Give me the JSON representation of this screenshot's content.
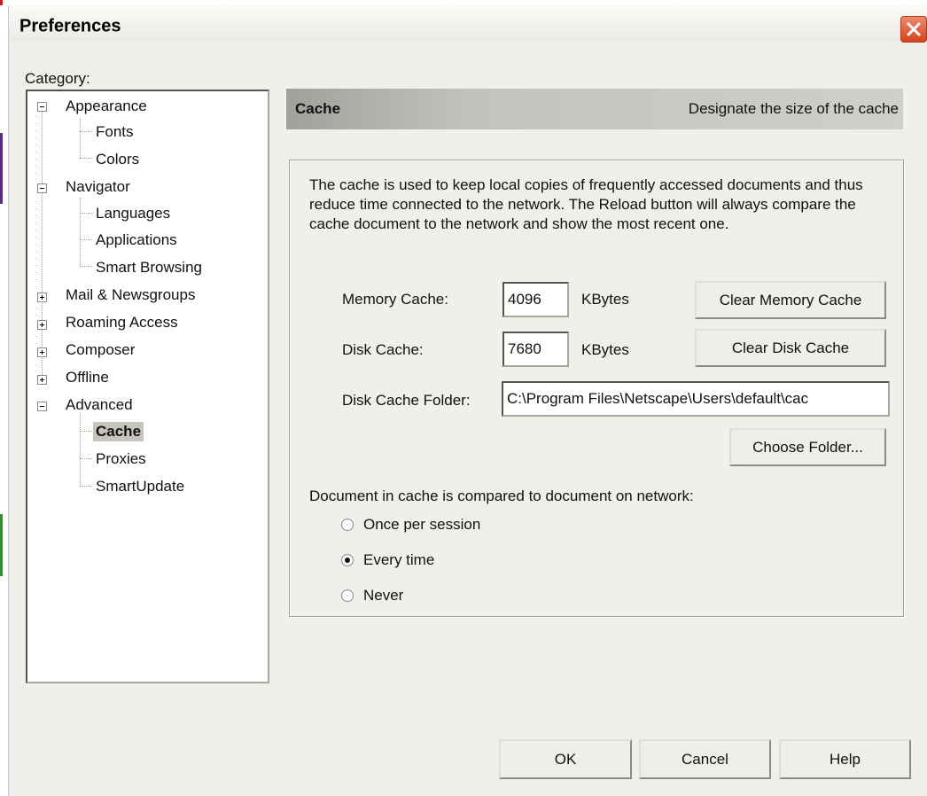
{
  "window": {
    "title": "Preferences"
  },
  "category": {
    "label": "Category:",
    "tree": [
      {
        "label": "Appearance",
        "expander": "minus"
      },
      {
        "label": "Fonts"
      },
      {
        "label": "Colors"
      },
      {
        "label": "Navigator",
        "expander": "minus"
      },
      {
        "label": "Languages"
      },
      {
        "label": "Applications"
      },
      {
        "label": "Smart Browsing"
      },
      {
        "label": "Mail & Newsgroups",
        "expander": "plus"
      },
      {
        "label": "Roaming Access",
        "expander": "plus"
      },
      {
        "label": "Composer",
        "expander": "plus"
      },
      {
        "label": "Offline",
        "expander": "plus"
      },
      {
        "label": "Advanced",
        "expander": "minus"
      },
      {
        "label": "Cache",
        "selected": true
      },
      {
        "label": "Proxies"
      },
      {
        "label": "SmartUpdate"
      }
    ]
  },
  "panel": {
    "title": "Cache",
    "description": "Designate the size of the cache",
    "intro": "The cache is used to keep local copies of frequently accessed documents and thus reduce time connected to the network. The Reload button will always compare the cache document to the network and show the most recent one.",
    "memory_cache": {
      "label": "Memory Cache:",
      "value": "4096",
      "unit": "KBytes",
      "button": "Clear Memory Cache"
    },
    "disk_cache": {
      "label": "Disk Cache:",
      "value": "7680",
      "unit": "KBytes",
      "button": "Clear Disk Cache"
    },
    "disk_folder": {
      "label": "Disk Cache Folder:",
      "value": "C:\\Program Files\\Netscape\\Users\\default\\cac",
      "button": "Choose Folder..."
    },
    "compare": {
      "label": "Document in cache is compared to document on network:",
      "options": [
        {
          "label": "Once per session",
          "checked": false
        },
        {
          "label": "Every time",
          "checked": true
        },
        {
          "label": "Never",
          "checked": false
        }
      ]
    }
  },
  "footer": {
    "ok": "OK",
    "cancel": "Cancel",
    "help": "Help"
  },
  "colors": {
    "dialog_bg": "#f0f0eb",
    "close_button": "#d4431e",
    "header_bar": "#c3c2bd"
  },
  "icons": {
    "close": "close-icon",
    "tree_collapse": "minus-box-icon",
    "tree_expand": "plus-box-icon"
  }
}
